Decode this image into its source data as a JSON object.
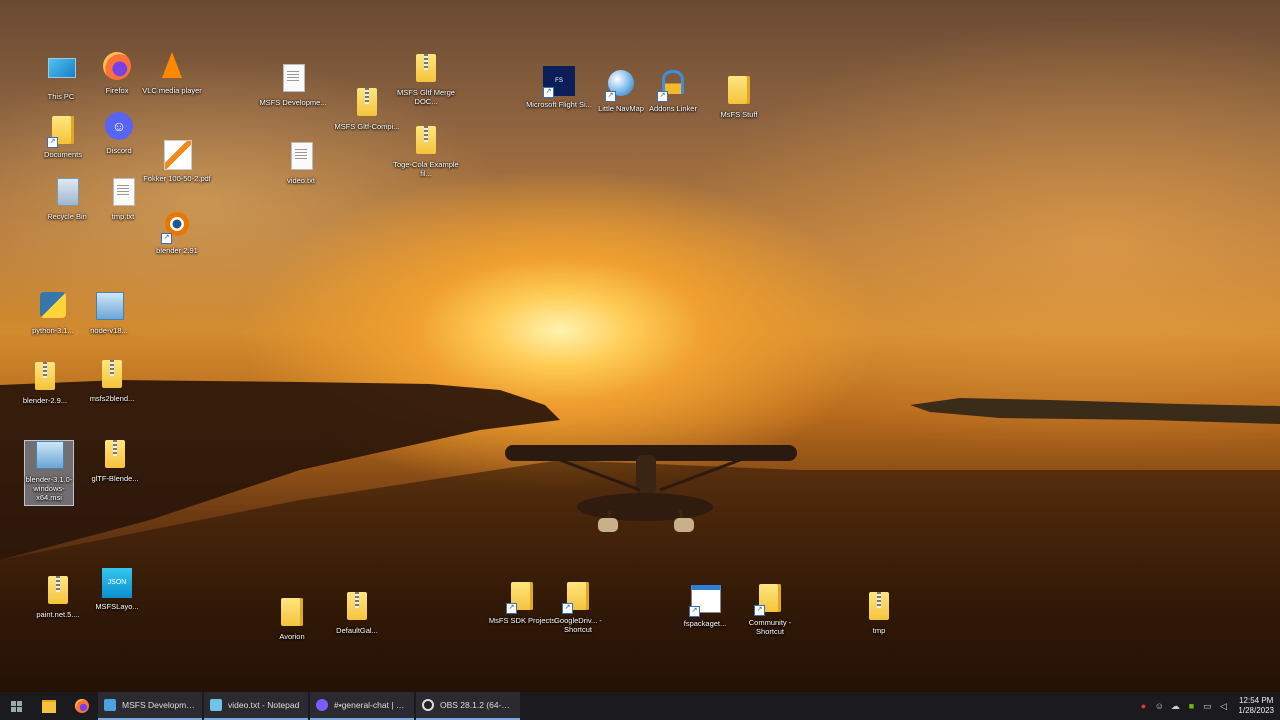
{
  "desktop": {
    "icons": [
      {
        "label": "This PC",
        "type": "pc"
      },
      {
        "label": "Firefox",
        "type": "firefox"
      },
      {
        "label": "VLC media player",
        "type": "vlc"
      },
      {
        "label": "Documents",
        "type": "folder-shortcut"
      },
      {
        "label": "Discord",
        "type": "discord"
      },
      {
        "label": "Fokker 100-50-2.pdf",
        "type": "pdf"
      },
      {
        "label": "Recycle Bin",
        "type": "recycle"
      },
      {
        "label": "tmp.txt",
        "type": "doc"
      },
      {
        "label": "blender 2.91",
        "type": "blender"
      },
      {
        "label": "python-3.1...",
        "type": "python"
      },
      {
        "label": "node-v18...",
        "type": "installer"
      },
      {
        "label": "blender-2.9...",
        "type": "zip"
      },
      {
        "label": "msfs2blend...",
        "type": "zip"
      },
      {
        "label": "blender-3.1.0-windows-x64.msi",
        "type": "installer"
      },
      {
        "label": "glTF-Blende...",
        "type": "zip"
      },
      {
        "label": "paint.net.5....",
        "type": "zip"
      },
      {
        "label": "MSFSLayo...",
        "type": "json"
      },
      {
        "label": "MSFS Developme...",
        "type": "doc"
      },
      {
        "label": "video.txt",
        "type": "doc"
      },
      {
        "label": "MSFS Gltf-Compi...",
        "type": "zip"
      },
      {
        "label": "MSFS Gltf Merge DOC...",
        "type": "zip"
      },
      {
        "label": "Toge-Cola Example fil...",
        "type": "zip"
      },
      {
        "label": "Microsoft Flight Si...",
        "type": "msfs"
      },
      {
        "label": "Little NavMap",
        "type": "navmap"
      },
      {
        "label": "Addons Linker",
        "type": "linker"
      },
      {
        "label": "MsFS Stuff",
        "type": "folder"
      },
      {
        "label": "Avorion",
        "type": "folder"
      },
      {
        "label": "DefaultGal...",
        "type": "zip"
      },
      {
        "label": "MsFS SDK Projects",
        "type": "folder-shortcut"
      },
      {
        "label": "GoogleDriv... - Shortcut",
        "type": "folder-shortcut"
      },
      {
        "label": "fspackaget...",
        "type": "app"
      },
      {
        "label": "Community - Shortcut",
        "type": "folder-shortcut"
      },
      {
        "label": "tmp",
        "type": "zip"
      }
    ]
  },
  "taskbar": {
    "apps": [
      {
        "label": "MSFS Development...",
        "color": "#4aa3df"
      },
      {
        "label": "video.txt - Notepad",
        "color": "#6fc4e8"
      },
      {
        "label": "#•general-chat | B...",
        "color": "#7b5cff"
      },
      {
        "label": "OBS 28.1.2 (64-bit, ...",
        "color": "#202020"
      }
    ],
    "clock": {
      "time": "12:54 PM",
      "date": "1/28/2023"
    }
  },
  "colors": {
    "accent": "#7aa8e0",
    "taskbar": "#1b1b1f"
  }
}
